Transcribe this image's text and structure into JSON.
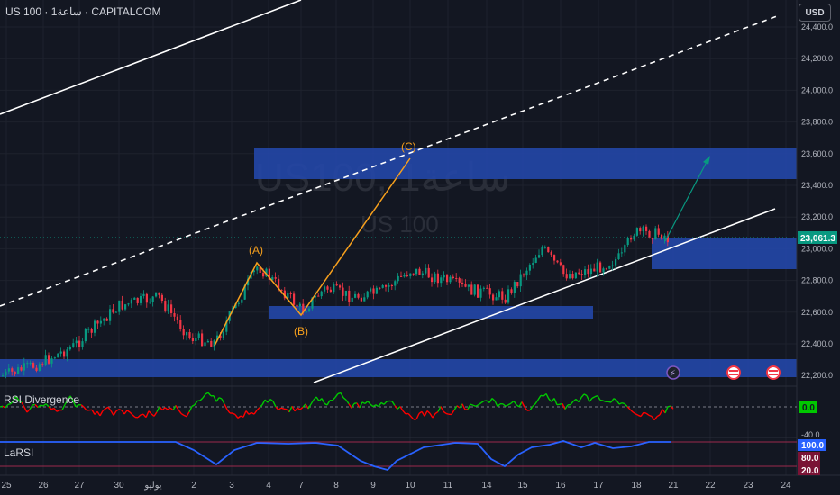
{
  "header": {
    "title": "US 100 · 1ساعة · CAPITALCOM",
    "currency": "USD"
  },
  "watermark": {
    "line1": "US100, 1ساعة",
    "line2": "US 100"
  },
  "price_axis": {
    "ticks": [
      "24,400.0",
      "24,200.0",
      "24,000.0",
      "23,800.0",
      "23,600.0",
      "23,400.0",
      "23,200.0",
      "23,000.0",
      "22,800.0",
      "22,600.0",
      "22,400.0",
      "22,200.0"
    ]
  },
  "time_axis": {
    "ticks": [
      "25",
      "26",
      "27",
      "30",
      "يوليو",
      "2",
      "3",
      "4",
      "7",
      "8",
      "9",
      "10",
      "11",
      "14",
      "15",
      "16",
      "17",
      "18",
      "21",
      "22",
      "23",
      "24"
    ]
  },
  "current_price": {
    "label": "23,061.3",
    "color": "#089981"
  },
  "elliott": {
    "labels": [
      "(A)",
      "(B)",
      "(C)"
    ],
    "color": "#f7a01d"
  },
  "rsi_div": {
    "label": "RSI Divergence",
    "value": "0.0",
    "value_color": "#00c800"
  },
  "larsi": {
    "label": "LaRSI",
    "axis": [
      "-40.0"
    ],
    "badges": [
      "100.0",
      "80.0",
      "20.0"
    ]
  },
  "colors": {
    "background": "#131722",
    "zone": "#2447a8",
    "up": "#089981",
    "down": "#f23645",
    "line": "#ffffff",
    "rsi_green": "#00c800",
    "rsi_red": "#ff0000",
    "larsi_line": "#2962ff"
  },
  "icons": [
    "lightning-icon",
    "us-flag-icon",
    "us-flag-icon"
  ]
}
